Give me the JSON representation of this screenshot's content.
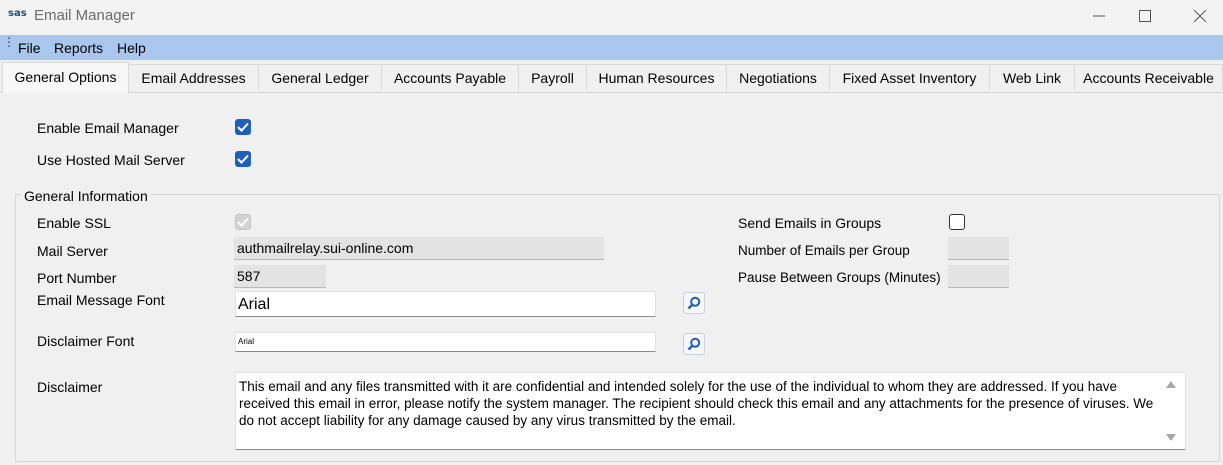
{
  "window": {
    "app_logo": "sas",
    "title": "Email Manager",
    "buttons": [
      "minimize",
      "maximize",
      "close"
    ]
  },
  "menu": {
    "items": [
      "File",
      "Reports",
      "Help"
    ]
  },
  "tabs": [
    {
      "label": "General Options",
      "active": true
    },
    {
      "label": "Email Addresses"
    },
    {
      "label": "General Ledger"
    },
    {
      "label": "Accounts Payable"
    },
    {
      "label": "Payroll"
    },
    {
      "label": "Human Resources"
    },
    {
      "label": "Negotiations"
    },
    {
      "label": "Fixed Asset Inventory"
    },
    {
      "label": "Web Link"
    },
    {
      "label": "Accounts Receivable"
    }
  ],
  "options": {
    "enable_email_manager": {
      "label": "Enable Email Manager",
      "checked": true
    },
    "use_hosted_mail_server": {
      "label": "Use Hosted Mail Server",
      "checked": true
    }
  },
  "general_info": {
    "title": "General Information",
    "enable_ssl": {
      "label": "Enable SSL",
      "checked": true,
      "disabled": true
    },
    "mail_server": {
      "label": "Mail Server",
      "value": "authmailrelay.sui-online.com"
    },
    "port_number": {
      "label": "Port Number",
      "value": "587"
    },
    "email_message_font": {
      "label": "Email Message Font",
      "value": "Arial"
    },
    "disclaimer_font": {
      "label": "Disclaimer Font",
      "value": "Arial"
    },
    "disclaimer": {
      "label": "Disclaimer",
      "value": "This email and any files transmitted with it are confidential and intended solely for the use of the individual to whom they are addressed.  If you have received this email in error, please notify the system manager.  The recipient should check this email and any attachments for the presence of viruses.  We do not accept liability for any damage caused by any virus transmitted by the email."
    },
    "send_in_groups": {
      "label": "Send Emails in Groups",
      "checked": false
    },
    "emails_per_group": {
      "label": "Number of Emails per Group",
      "value": ""
    },
    "pause_between_groups": {
      "label": "Pause Between Groups (Minutes)",
      "value": ""
    }
  },
  "colors": {
    "accent": "#1e5fbd",
    "menubar": "#a9c6ee"
  }
}
